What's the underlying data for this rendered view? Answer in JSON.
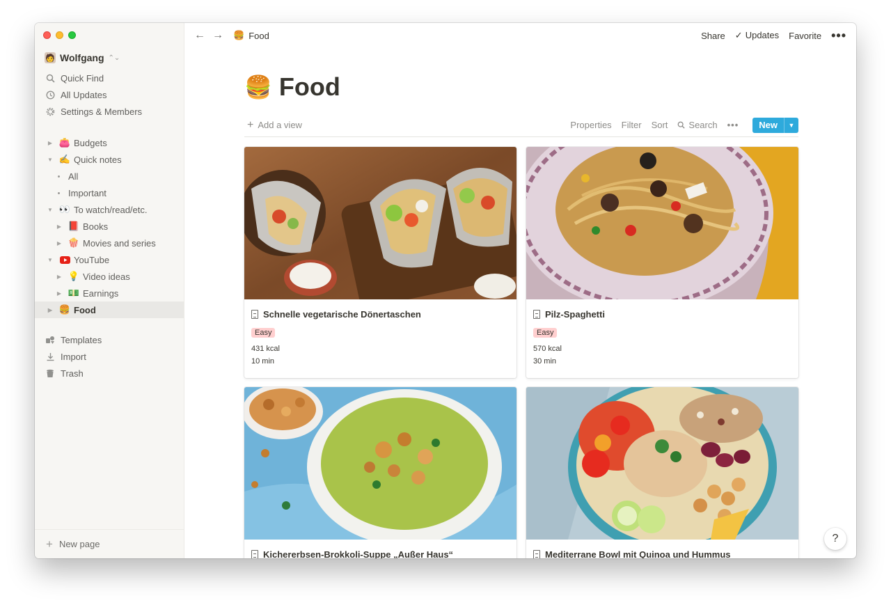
{
  "sidebar": {
    "workspace": "Wolfgang",
    "top_items": [
      {
        "label": "Quick Find",
        "icon": "search-icon"
      },
      {
        "label": "All Updates",
        "icon": "clock-icon"
      },
      {
        "label": "Settings & Members",
        "icon": "gear-icon"
      }
    ],
    "tree": {
      "budgets": {
        "emoji": "👛",
        "label": "Budgets"
      },
      "quick_notes": {
        "emoji": "✍️",
        "label": "Quick notes"
      },
      "all": {
        "label": "All"
      },
      "important": {
        "label": "Important"
      },
      "to_watch": {
        "emoji": "👀",
        "label": "To watch/read/etc."
      },
      "books": {
        "emoji": "📕",
        "label": "Books"
      },
      "movies": {
        "emoji": "🍿",
        "label": "Movies and series"
      },
      "youtube": {
        "emoji": "▶️",
        "label": "YouTube"
      },
      "video_ideas": {
        "emoji": "💡",
        "label": "Video ideas"
      },
      "earnings": {
        "emoji": "💵",
        "label": "Earnings"
      },
      "food": {
        "emoji": "🍔",
        "label": "Food"
      }
    },
    "bottom_items": [
      {
        "label": "Templates",
        "icon": "templates-icon"
      },
      {
        "label": "Import",
        "icon": "import-icon"
      },
      {
        "label": "Trash",
        "icon": "trash-icon"
      }
    ],
    "new_page": "New page"
  },
  "topbar": {
    "breadcrumb_emoji": "🍔",
    "breadcrumb": "Food",
    "share": "Share",
    "updates": "Updates",
    "favorite": "Favorite"
  },
  "page": {
    "emoji": "🍔",
    "title": "Food",
    "add_view": "Add a view",
    "tools": {
      "properties": "Properties",
      "filter": "Filter",
      "sort": "Sort",
      "search": "Search"
    },
    "new_button": "New"
  },
  "cards": [
    {
      "title": "Schnelle vegetarische Dönertaschen",
      "tag": "Easy",
      "kcal": "431 kcal",
      "time": "10 min"
    },
    {
      "title": "Pilz-Spaghetti",
      "tag": "Easy",
      "kcal": "570 kcal",
      "time": "30 min"
    },
    {
      "title": "Kichererbsen-Brokkoli-Suppe „Außer Haus“"
    },
    {
      "title": "Mediterrane Bowl mit Quinoa und Hummus"
    }
  ],
  "help": "?",
  "colors": {
    "accent": "#2eaadc",
    "tag_bg": "#ffcfcf",
    "sidebar_bg": "#f7f6f3",
    "active_bg": "#e9e8e5"
  }
}
